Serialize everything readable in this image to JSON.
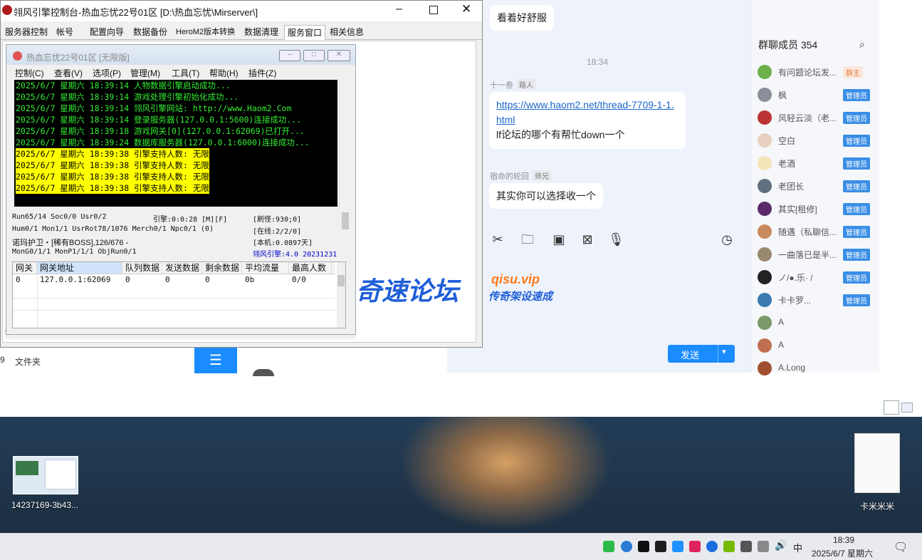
{
  "chat": {
    "messages": [
      {
        "text": "看着好舒服"
      },
      {
        "time": "18:34"
      },
      {
        "sender": "十一叁",
        "tag": "路人",
        "link": "https://www.haom2.net/thread-7709-1-1.html",
        "text": "lf论坛的哪个有帮忙down一个"
      },
      {
        "sender": "宿命的轮回",
        "tag": "师兄",
        "text": "其实你可以选择收一个"
      }
    ],
    "members_title": "群聊成员 354",
    "members": [
      {
        "name": "有问题论坛发...",
        "badge": "群主"
      },
      {
        "name": "枫",
        "badge": "管理员"
      },
      {
        "name": "风轻云淡（老...",
        "badge": "管理员"
      },
      {
        "name": "空白",
        "badge": "管理员"
      },
      {
        "name": "老酒",
        "badge": "管理员"
      },
      {
        "name": "老团长",
        "badge": "管理员"
      },
      {
        "name": "其实[租修]",
        "badge": "管理员"
      },
      {
        "name": "随遇（私聊信...",
        "badge": "管理员"
      },
      {
        "name": "一曲落已是半...",
        "badge": "管理员"
      },
      {
        "name": "ノ/●.乐· /",
        "badge": "管理员"
      },
      {
        "name": "卡卡罗...",
        "badge": "管理员"
      },
      {
        "name": "A",
        "badge": ""
      },
      {
        "name": "A",
        "badge": ""
      },
      {
        "name": "A.Long",
        "badge": ""
      }
    ],
    "send_label": "发送"
  },
  "main_window": {
    "title": "翎风引擎控制台-热血忘忧22号01区 [D:\\热血忘忧\\Mirserver\\]",
    "tabs": [
      "服务器控制",
      "帐号",
      "配置向导",
      "数据备份",
      "HeroM2版本转换",
      "数据清理",
      "服务窗口",
      "相关信息"
    ],
    "active_tab": "服务窗口"
  },
  "inner_window": {
    "title": "热血忘忧22号01区 [无限版]",
    "menu": [
      "控制(C)",
      "查看(V)",
      "选项(P)",
      "管理(M)",
      "工具(T)",
      "帮助(H)",
      "插件(Z)"
    ],
    "log": [
      {
        "text": "2025/6/7 星期六 18:39:14 人物数据引擎启动成功...",
        "hl": false
      },
      {
        "text": "2025/6/7 星期六 18:39:14 游戏处理引擎初始化成功...",
        "hl": false
      },
      {
        "text": "2025/6/7 星期六 18:39:14 翎风引擎网站: http://www.Haom2.Com",
        "hl": false
      },
      {
        "text": "2025/6/7 星期六 18:39:14 登录服务器(127.0.0.1:5600)连接成功...",
        "hl": false
      },
      {
        "text": "2025/6/7 星期六 18:39:18 游戏网关[0](127.0.0.1:62069)已打开...",
        "hl": false
      },
      {
        "text": "2025/6/7 星期六 18:39:24 数据库服务器(127.0.0.1:6000)连接成功...",
        "hl": false
      },
      {
        "text": "2025/6/7 星期六 18:39:38 引擎支持人数: 无限",
        "hl": true
      },
      {
        "text": "2025/6/7 星期六 18:39:38 引擎支持人数: 无限",
        "hl": true
      },
      {
        "text": "2025/6/7 星期六 18:39:38 引擎支持人数: 无限",
        "hl": true
      },
      {
        "text": "2025/6/7 星期六 18:39:38 引擎支持人数: 无限",
        "hl": true
      }
    ],
    "stats": {
      "l1": "Run65/14 Soc0/0 Usr0/2",
      "l1b": "引擎:0:0:28 [M][F]",
      "l1c": "[刷怪:930;0]",
      "l2": "Hum0/1 Mon1/1 UsrRot78/1076 Merch0/1 Npc0/1 (0)",
      "l2c": "[在线:2/2/0]",
      "l3": "诺玛护卫・[稀有BOSS],126/676 -",
      "l3c": "[本机:0.0897天]",
      "l4": "MonG0/1/1 MonP1/1/1 ObjRun0/1",
      "l4c": "翎风引擎:4.0 20231231"
    },
    "grid_headers": [
      "网关",
      "网关地址",
      "队列数据",
      "发送数据",
      "剩余数据",
      "平均流量",
      "最高人数"
    ],
    "grid_row": [
      "0",
      "127.0.0.1:62069",
      "0",
      "0",
      "0",
      "0b",
      "0/0"
    ]
  },
  "explorer": {
    "label": "文件夹",
    "num": "9"
  },
  "watermark": {
    "main": "奇速论坛",
    "sub": "qisu.vip",
    "sub2": "传奇架设速成"
  },
  "desktop_icons": [
    "14237169-3b43...",
    "卡米米米"
  ],
  "taskbar": {
    "time": "18:39",
    "date": "2025/6/7 星期六",
    "ime": "中"
  }
}
